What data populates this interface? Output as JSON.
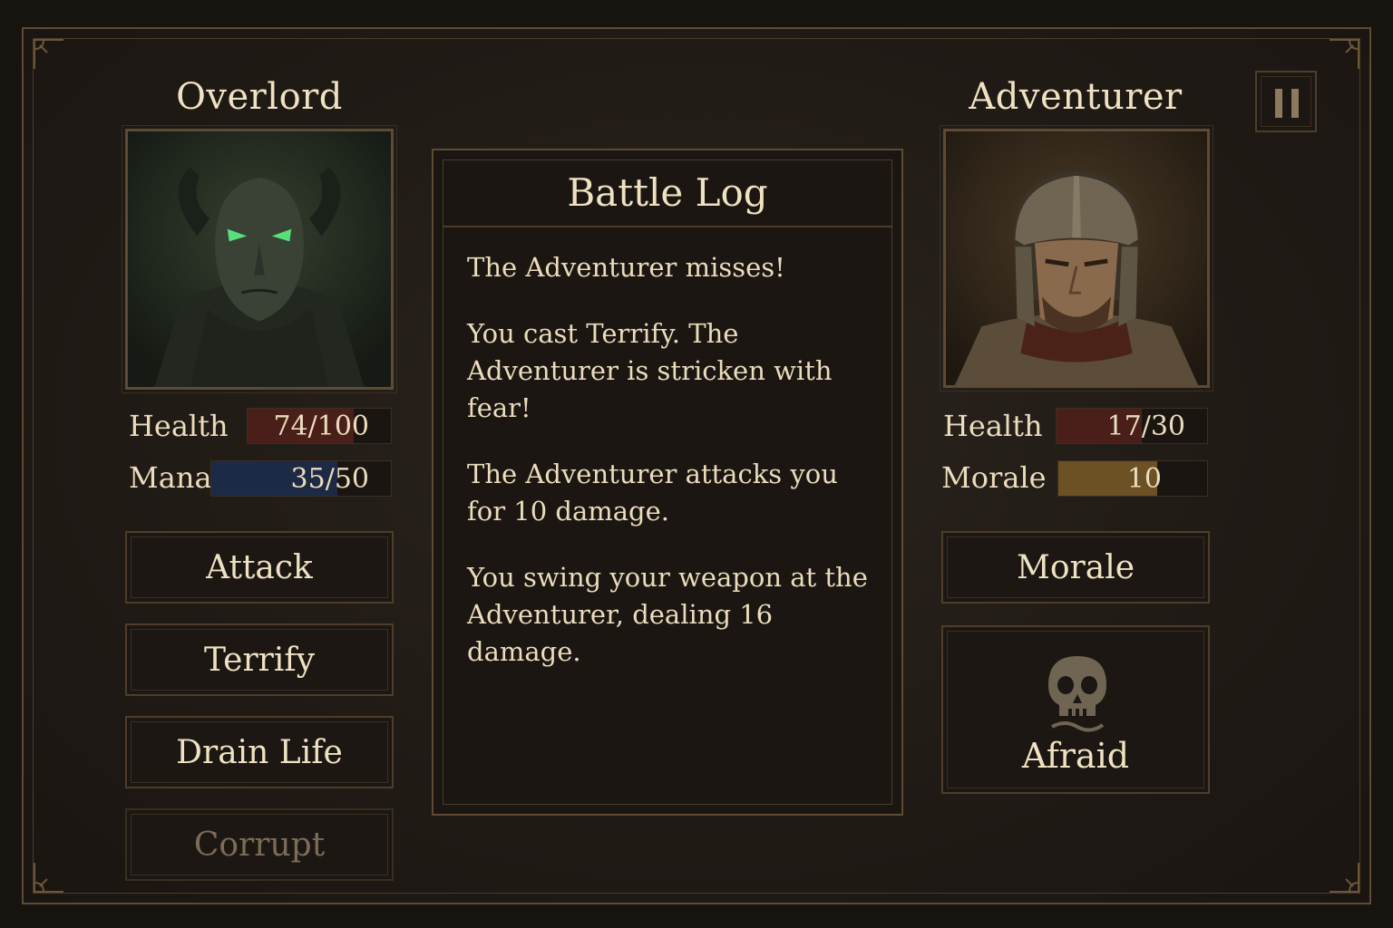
{
  "overlord": {
    "name": "Overlord",
    "health": {
      "label": "Health",
      "text": "74/100",
      "value": 74,
      "max": 100
    },
    "mana": {
      "label": "Mana",
      "text": "35/50",
      "value": 35,
      "max": 50
    },
    "portrait_icon": "demon-overlord-portrait"
  },
  "adventurer": {
    "name": "Adventurer",
    "health": {
      "label": "Health",
      "text": "17/30",
      "value": 17,
      "max": 30
    },
    "morale": {
      "label": "Morale",
      "text": "10",
      "value": 10,
      "max": 15
    },
    "portrait_icon": "helmeted-knight-portrait",
    "morale_button": "Morale",
    "status": {
      "label": "Afraid",
      "icon": "skull-icon"
    }
  },
  "actions": [
    {
      "label": "Attack",
      "enabled": true
    },
    {
      "label": "Terrify",
      "enabled": true
    },
    {
      "label": "Drain Life",
      "enabled": true
    },
    {
      "label": "Corrupt",
      "enabled": false
    }
  ],
  "battle_log": {
    "title": "Battle Log",
    "entries": [
      "The Adventurer misses!",
      "You cast Terrify. The Adventurer is stricken with fear!",
      "The Adventurer attacks you for 10 damage.",
      "You swing your weapon at the Adventurer, dealing 16 damage."
    ]
  },
  "pause_icon": "pause-icon",
  "colors": {
    "health_fill": "#4a1f1a",
    "mana_fill": "#1d2a45",
    "morale_fill": "#6b5124",
    "text": "#eadcbc",
    "border": "#5d4b33"
  }
}
